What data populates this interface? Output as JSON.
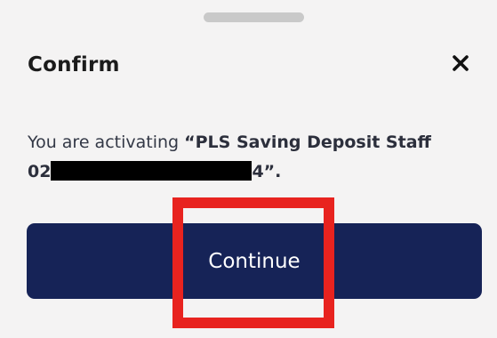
{
  "dialog": {
    "title": "Confirm",
    "close_icon": "close-icon",
    "message_prefix": "You are activating ",
    "product_name_line1": "“PLS Saving Deposit Staff",
    "product_name_line2_start": "02",
    "product_name_line2_end": "4”",
    "message_suffix": ".",
    "continue_label": "Continue"
  },
  "colors": {
    "background": "#f4f3f3",
    "button": "#162357",
    "button_text": "#ffffff",
    "highlight": "#e8231f",
    "redaction": "#000000",
    "handle": "#c9c9c9"
  }
}
